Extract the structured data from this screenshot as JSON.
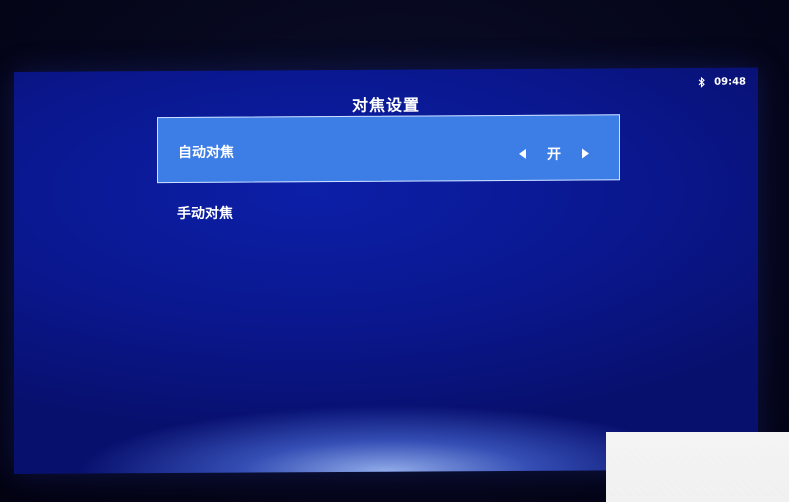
{
  "status_bar": {
    "bluetooth_icon": "bluetooth-icon",
    "time": "09:48"
  },
  "page": {
    "title": "对焦设置"
  },
  "menu": {
    "items": [
      {
        "label": "自动对焦",
        "value": "开",
        "selected": true,
        "left_icon": "left-arrow-icon",
        "right_icon": "right-arrow-icon"
      },
      {
        "label": "手动对焦",
        "selected": false
      }
    ]
  },
  "colors": {
    "background": "#0a178e",
    "selected_item": "#3d7de6",
    "text": "#ffffff"
  }
}
